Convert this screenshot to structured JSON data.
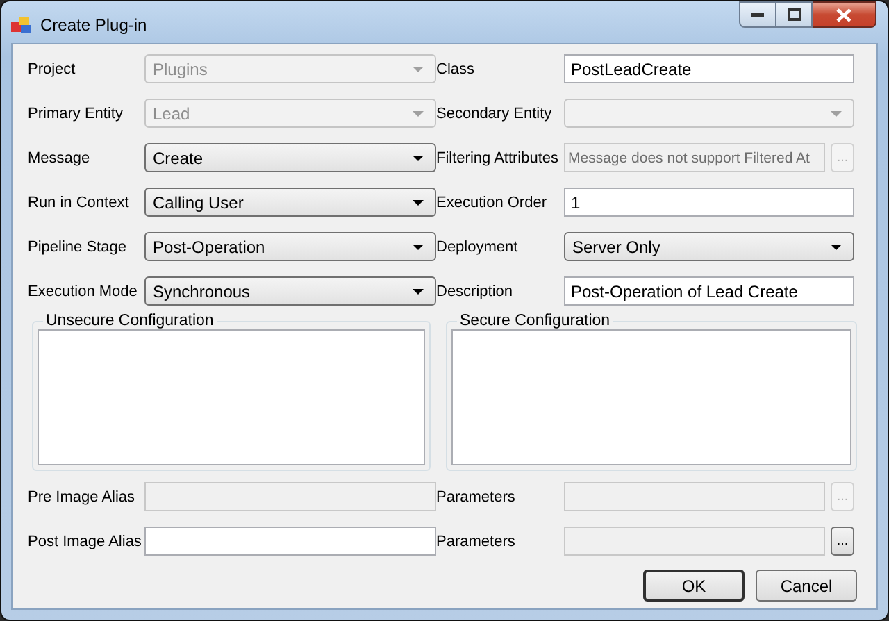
{
  "window": {
    "title": "Create Plug-in"
  },
  "fields": [
    {
      "label": "Project",
      "kind": "combo",
      "value": "Plugins",
      "disabled": true
    },
    {
      "label": "Class",
      "kind": "text",
      "value": "PostLeadCreate",
      "disabled": false
    },
    {
      "label": "Primary Entity",
      "kind": "combo",
      "value": "Lead",
      "disabled": true
    },
    {
      "label": "Secondary Entity",
      "kind": "combo",
      "disabled": true
    },
    {
      "label": "Message",
      "kind": "combo",
      "value": "Create",
      "disabled": false
    },
    {
      "label": "Filtering Attributes",
      "kind": "browse",
      "value": "Message does not support Filtered At",
      "disabled": true,
      "button": "...",
      "button_disabled": true
    },
    {
      "label": "Run in Context",
      "kind": "combo",
      "value": "Calling User",
      "disabled": false
    },
    {
      "label": "Execution Order",
      "kind": "text",
      "value": "1",
      "disabled": false
    },
    {
      "label": "Pipeline Stage",
      "kind": "combo",
      "value": "Post-Operation",
      "disabled": false
    },
    {
      "label": "Deployment",
      "kind": "combo",
      "value": "Server Only",
      "disabled": false
    },
    {
      "label": "Execution Mode",
      "kind": "combo",
      "value": "Synchronous",
      "disabled": false
    },
    {
      "label": "Description",
      "kind": "text",
      "value": "Post-Operation of Lead Create",
      "disabled": false
    }
  ],
  "config_groups": [
    {
      "label": "Unsecure Configuration"
    },
    {
      "label": "Secure Configuration"
    }
  ],
  "image_fields": [
    {
      "label": "Pre Image Alias",
      "kind": "text",
      "disabled": true
    },
    {
      "label": "Parameters",
      "kind": "browse",
      "disabled": true,
      "button": "...",
      "button_disabled": true
    },
    {
      "label": "Post Image Alias",
      "kind": "text",
      "disabled": false
    },
    {
      "label": "Parameters",
      "kind": "browse",
      "disabled": true,
      "button": "...",
      "button_disabled": false
    }
  ],
  "buttons": [
    {
      "label": "OK",
      "default": true
    },
    {
      "label": "Cancel",
      "default": false
    }
  ]
}
